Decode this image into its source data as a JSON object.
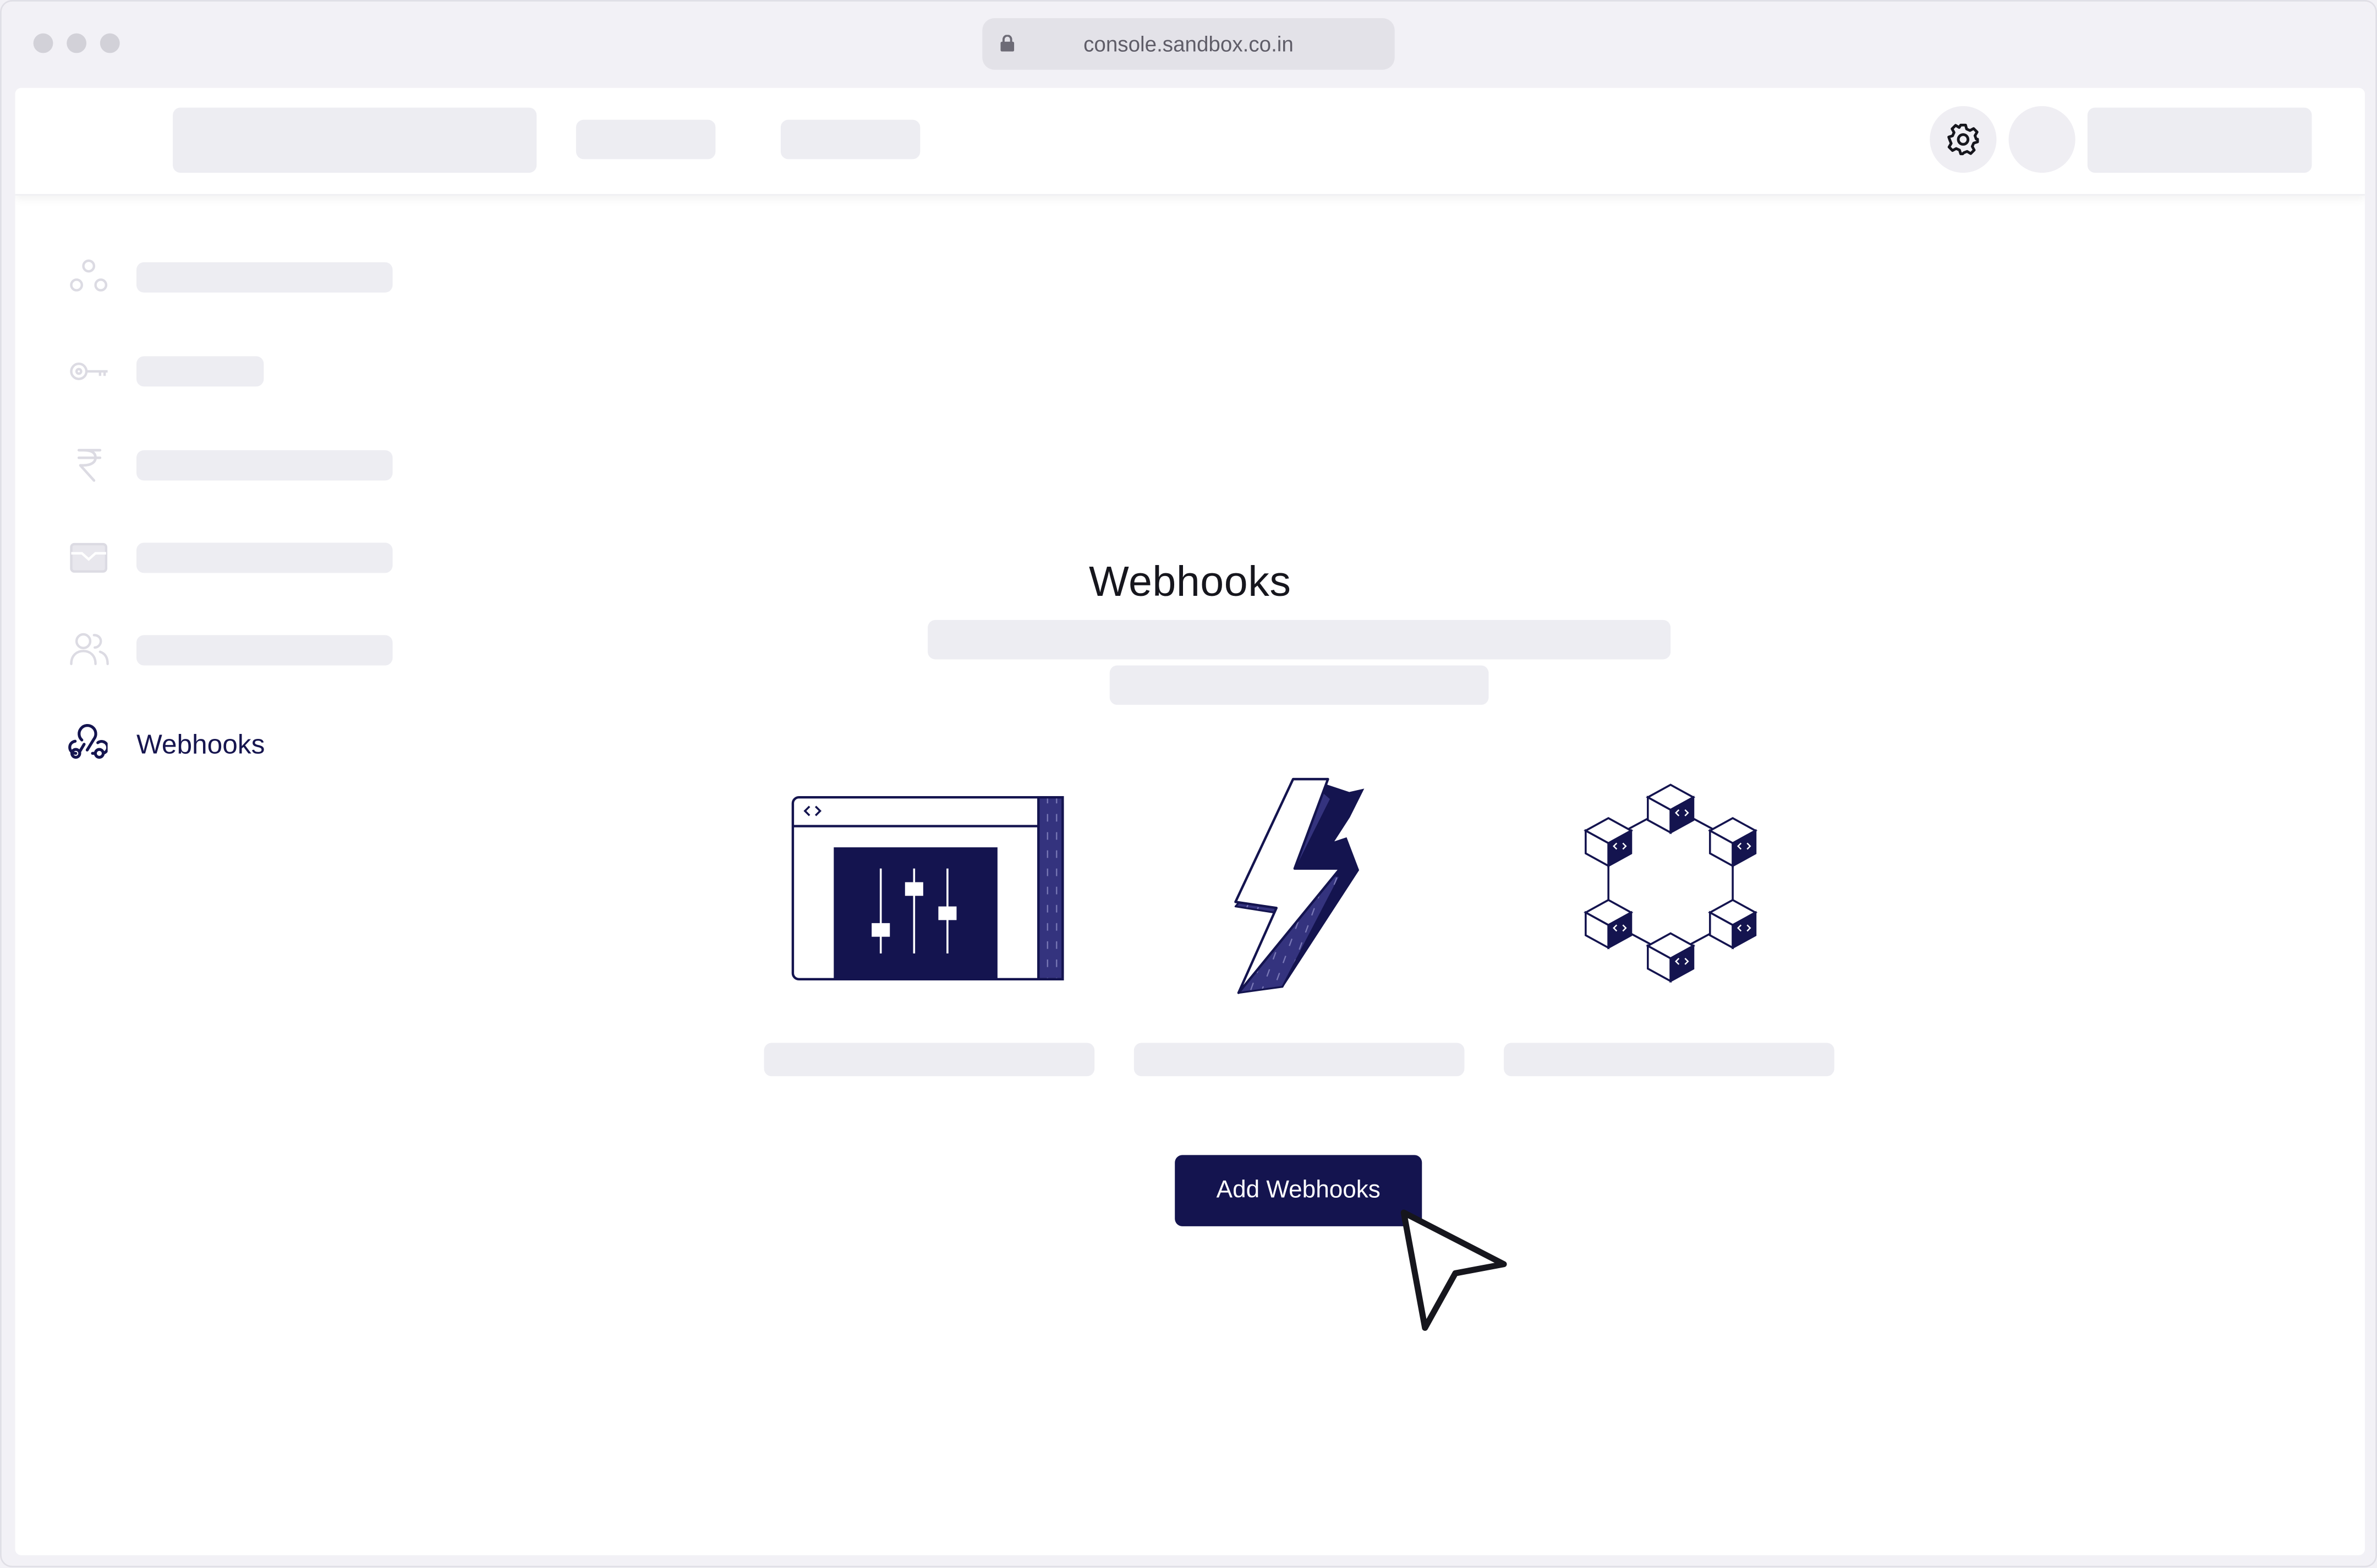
{
  "browser": {
    "url": "console.sandbox.co.in"
  },
  "sidebar": {
    "items": [
      {
        "icon": "nodes-icon"
      },
      {
        "icon": "key-icon"
      },
      {
        "icon": "rupee-icon"
      },
      {
        "icon": "card-icon"
      },
      {
        "icon": "users-icon"
      },
      {
        "icon": "webhook-icon",
        "label": "Webhooks",
        "active": true
      }
    ]
  },
  "main": {
    "title": "Webhooks",
    "add_button_label": "Add Webhooks",
    "illustrations": [
      "settings-window-icon",
      "lightning-bolt-icon",
      "cube-network-icon"
    ]
  },
  "colors": {
    "accent": "#14144f",
    "skeleton": "#ededf2",
    "background": "#f2f1f6",
    "inactive_icon": "#dcdbe3"
  }
}
